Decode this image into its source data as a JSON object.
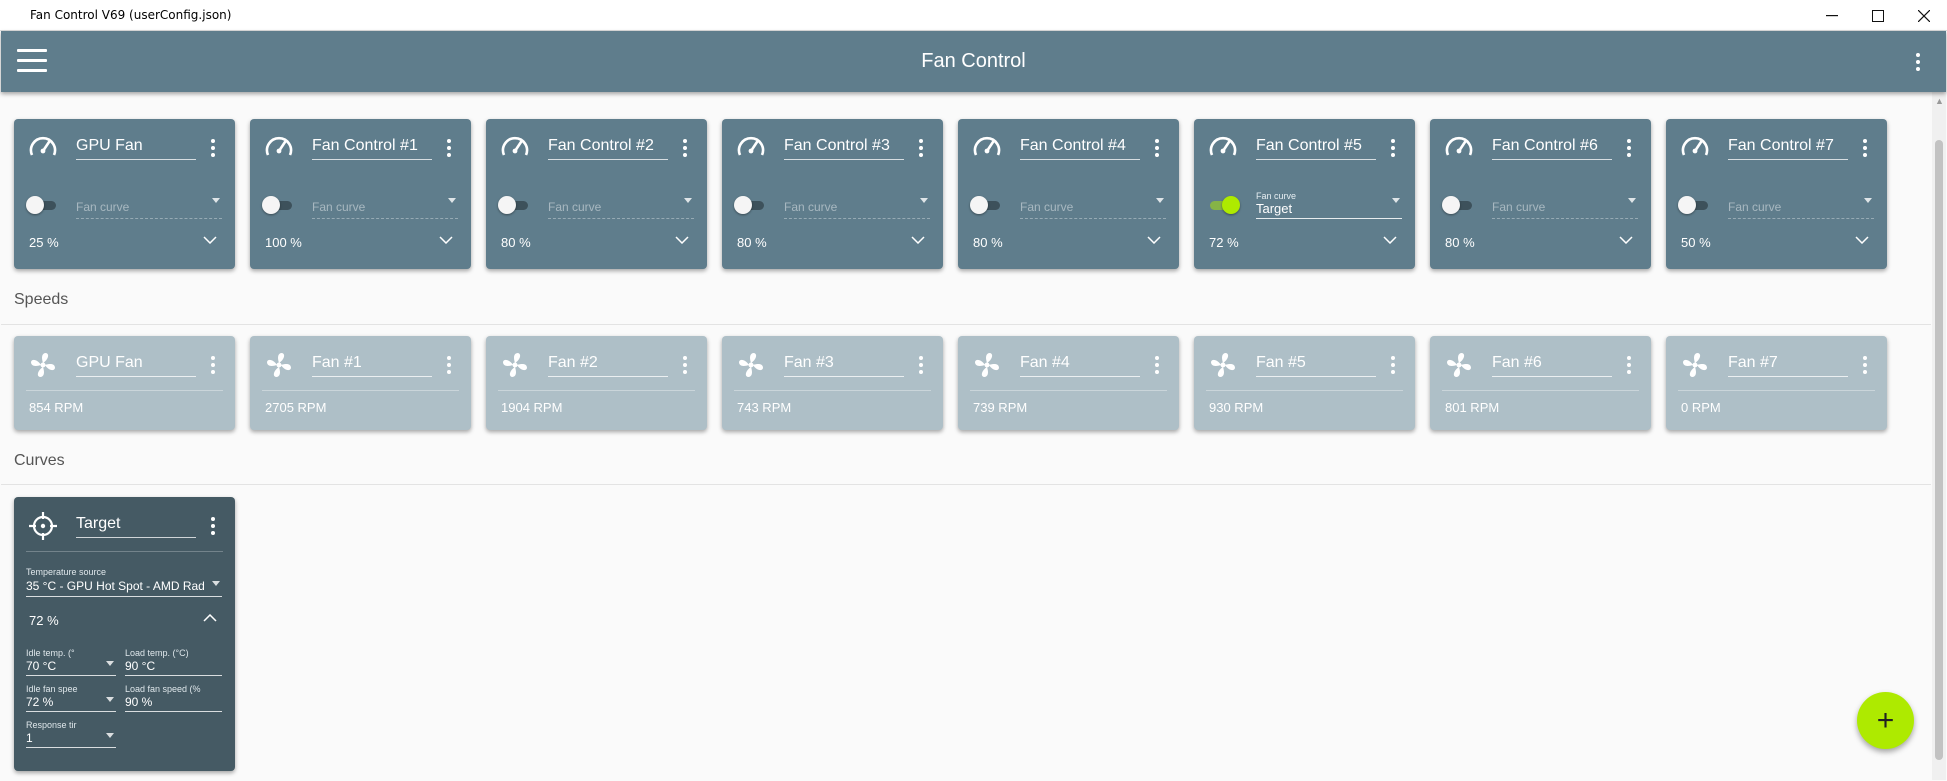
{
  "window": {
    "title": "Fan Control V69 (userConfig.json)",
    "minimize": "—",
    "maximize": "☐",
    "close": "✕"
  },
  "appbar": {
    "title": "Fan Control",
    "menu_icon": "hamburger-icon",
    "more_icon": "more-vert-icon"
  },
  "controls": [
    {
      "name": "GPU Fan",
      "enabled": false,
      "curve_placeholder": "Fan curve",
      "curve_label": "",
      "curve_value": "",
      "percent": "25 %"
    },
    {
      "name": "Fan Control #1",
      "enabled": false,
      "curve_placeholder": "Fan curve",
      "curve_label": "",
      "curve_value": "",
      "percent": "100 %"
    },
    {
      "name": "Fan Control #2",
      "enabled": false,
      "curve_placeholder": "Fan curve",
      "curve_label": "",
      "curve_value": "",
      "percent": "80 %"
    },
    {
      "name": "Fan Control #3",
      "enabled": false,
      "curve_placeholder": "Fan curve",
      "curve_label": "",
      "curve_value": "",
      "percent": "80 %"
    },
    {
      "name": "Fan Control #4",
      "enabled": false,
      "curve_placeholder": "Fan curve",
      "curve_label": "",
      "curve_value": "",
      "percent": "80 %"
    },
    {
      "name": "Fan Control #5",
      "enabled": true,
      "curve_placeholder": "",
      "curve_label": "Fan curve",
      "curve_value": "Target",
      "percent": "72 %"
    },
    {
      "name": "Fan Control #6",
      "enabled": false,
      "curve_placeholder": "Fan curve",
      "curve_label": "",
      "curve_value": "",
      "percent": "80 %"
    },
    {
      "name": "Fan Control #7",
      "enabled": false,
      "curve_placeholder": "Fan curve",
      "curve_label": "",
      "curve_value": "",
      "percent": "50 %"
    }
  ],
  "speeds_title": "Speeds",
  "speeds": [
    {
      "name": "GPU Fan",
      "rpm": "854 RPM"
    },
    {
      "name": "Fan #1",
      "rpm": "2705 RPM"
    },
    {
      "name": "Fan #2",
      "rpm": "1904 RPM"
    },
    {
      "name": "Fan #3",
      "rpm": "743 RPM"
    },
    {
      "name": "Fan #4",
      "rpm": "739 RPM"
    },
    {
      "name": "Fan #5",
      "rpm": "930 RPM"
    },
    {
      "name": "Fan #6",
      "rpm": "801 RPM"
    },
    {
      "name": "Fan #7",
      "rpm": "0 RPM"
    }
  ],
  "curves_title": "Curves",
  "curve": {
    "name": "Target",
    "temp_source_label": "Temperature source",
    "temp_source_value": "35 °C - GPU Hot Spot - AMD Rad",
    "percent": "72 %",
    "idle_temp_label": "Idle temp. (°",
    "idle_temp_value": "70 °C",
    "load_temp_label": "Load temp. (°C)",
    "load_temp_value": "90 °C",
    "idle_speed_label": "Idle fan spee",
    "idle_speed_value": "72 %",
    "load_speed_label": "Load fan speed (%",
    "load_speed_value": "90 %",
    "response_label": "Response tir",
    "response_value": "1"
  },
  "fab": {
    "label": "+",
    "icon": "add-icon"
  },
  "colors": {
    "appbar": "#5f7d8c",
    "control_card": "#5f7d8c",
    "speed_card": "#aebfc7",
    "curve_card": "#455a64",
    "accent": "#aeea00"
  }
}
